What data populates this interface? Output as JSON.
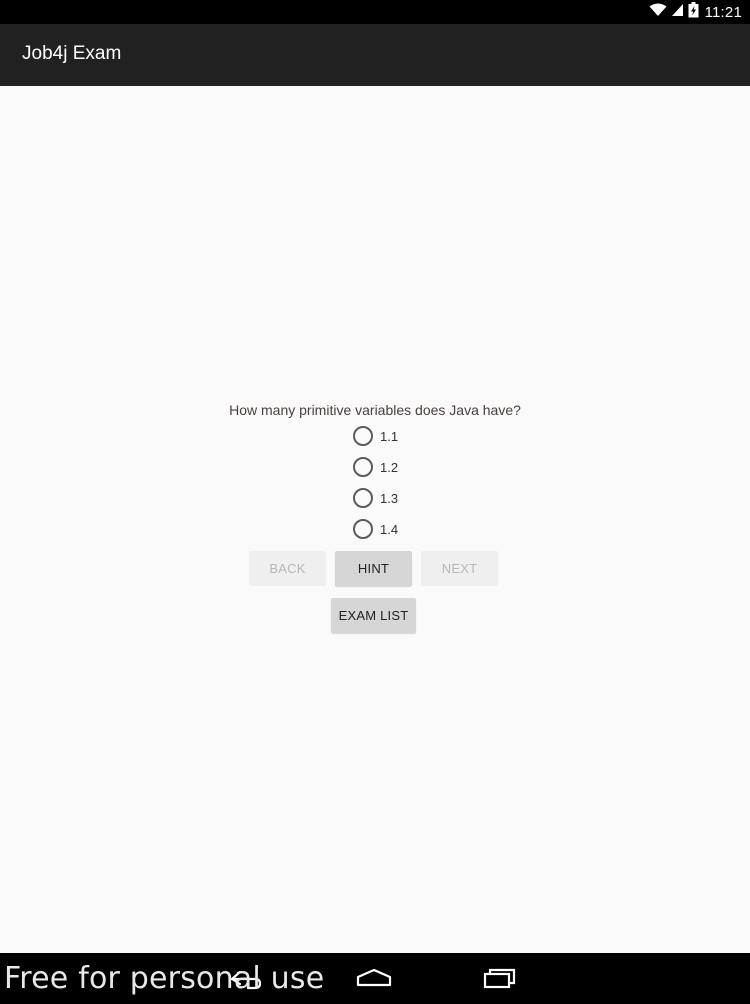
{
  "status_bar": {
    "time": "11:21",
    "icons": [
      "wifi-icon",
      "signal-icon",
      "battery-icon"
    ]
  },
  "app_bar": {
    "title": "Job4j Exam"
  },
  "exam": {
    "question": "How many primitive variables does Java have?",
    "options": [
      {
        "label": "1.1",
        "selected": false
      },
      {
        "label": "1.2",
        "selected": false
      },
      {
        "label": "1.3",
        "selected": false
      },
      {
        "label": "1.4",
        "selected": false
      }
    ],
    "buttons": {
      "back": {
        "label": "BACK",
        "enabled": false
      },
      "hint": {
        "label": "HINT",
        "enabled": true
      },
      "next": {
        "label": "NEXT",
        "enabled": false
      },
      "exam_list": {
        "label": "EXAM LIST",
        "enabled": true
      }
    }
  },
  "nav_bar": {
    "icons": [
      "back-icon",
      "home-icon",
      "recent-apps-icon"
    ]
  },
  "watermark": {
    "text": "Free for personal use"
  },
  "colors": {
    "app_bar": "#212121",
    "background": "#fafafa",
    "button_enabled": "#d6d6d6",
    "button_disabled": "#efefef"
  }
}
